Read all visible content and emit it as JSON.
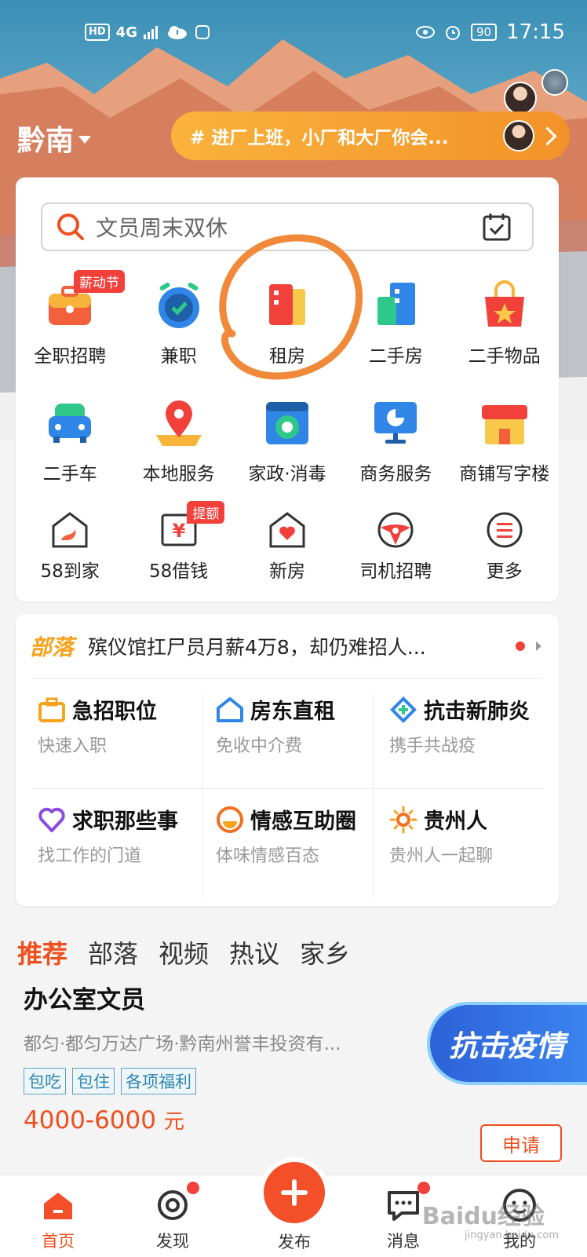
{
  "status_bar": {
    "left": [
      "HD",
      "4G"
    ],
    "battery": "90",
    "time": "17:15"
  },
  "header": {
    "city": "黔南",
    "banner_text": "# 进厂上班，小厂和大厂你会..."
  },
  "search": {
    "placeholder": "文员周末双休"
  },
  "categories": [
    [
      {
        "label": "全职招聘",
        "badge": "薪动节",
        "icon": "briefcase-icon"
      },
      {
        "label": "兼职",
        "icon": "stopwatch-icon"
      },
      {
        "label": "租房",
        "icon": "door-icon"
      },
      {
        "label": "二手房",
        "icon": "buildings-icon"
      },
      {
        "label": "二手物品",
        "icon": "shopping-bag-icon"
      }
    ],
    [
      {
        "label": "二手车",
        "icon": "car-icon"
      },
      {
        "label": "本地服务",
        "icon": "location-pin-icon"
      },
      {
        "label": "家政·消毒",
        "icon": "washing-machine-icon"
      },
      {
        "label": "商务服务",
        "icon": "monitor-chart-icon"
      },
      {
        "label": "商铺写字楼",
        "icon": "shop-icon"
      }
    ],
    [
      {
        "label": "58到家",
        "icon": "home-swan-icon"
      },
      {
        "label": "58借钱",
        "badge": "提额",
        "icon": "yen-icon"
      },
      {
        "label": "新房",
        "icon": "house-heart-icon"
      },
      {
        "label": "司机招聘",
        "icon": "steering-wheel-icon"
      },
      {
        "label": "更多",
        "icon": "menu-icon"
      }
    ]
  ],
  "tribe": {
    "logo": "部落",
    "headline": "殡仪馆扛尸员月薪4万8，却仍难招人..."
  },
  "tiles": [
    {
      "title": "急招职位",
      "sub": "快速入职",
      "icon": "bag-icon",
      "color": "#f7a21b"
    },
    {
      "title": "房东直租",
      "sub": "免收中介费",
      "icon": "house-icon",
      "color": "#2f86e6"
    },
    {
      "title": "抗击新肺炎",
      "sub": "携手共战疫",
      "icon": "diamond-plus-icon",
      "color": "#2f86e6"
    },
    {
      "title": "求职那些事",
      "sub": "找工作的门道",
      "icon": "heart-icon",
      "color": "#8a4ce0"
    },
    {
      "title": "情感互助圈",
      "sub": "体味情感百态",
      "icon": "smile-icon",
      "color": "#f37021"
    },
    {
      "title": "贵州人",
      "sub": "贵州人一起聊",
      "icon": "sun-icon",
      "color": "#f7a21b"
    }
  ],
  "feed_tabs": [
    "推荐",
    "部落",
    "视频",
    "热议",
    "家乡"
  ],
  "job": {
    "title": "办公室文员",
    "location": "都匀·都匀万达广场·黔南州誉丰投资有...",
    "tags": [
      "包吃",
      "包住",
      "各项福利"
    ],
    "salary": "4000-6000",
    "salary_unit": "元",
    "apply": "申请"
  },
  "floating_banner": "抗击疫情",
  "bottom_nav": [
    {
      "label": "首页",
      "active": true
    },
    {
      "label": "发现",
      "dot": true
    },
    {
      "label": "发布"
    },
    {
      "label": "消息",
      "dot": true
    },
    {
      "label": "我的"
    }
  ],
  "watermark": {
    "main": "Baidu经验",
    "sub": "jingyan.baidu.com"
  },
  "colors": {
    "accent": "#ef4f1d",
    "banner": "#f39229",
    "badge": "#f2413b"
  }
}
